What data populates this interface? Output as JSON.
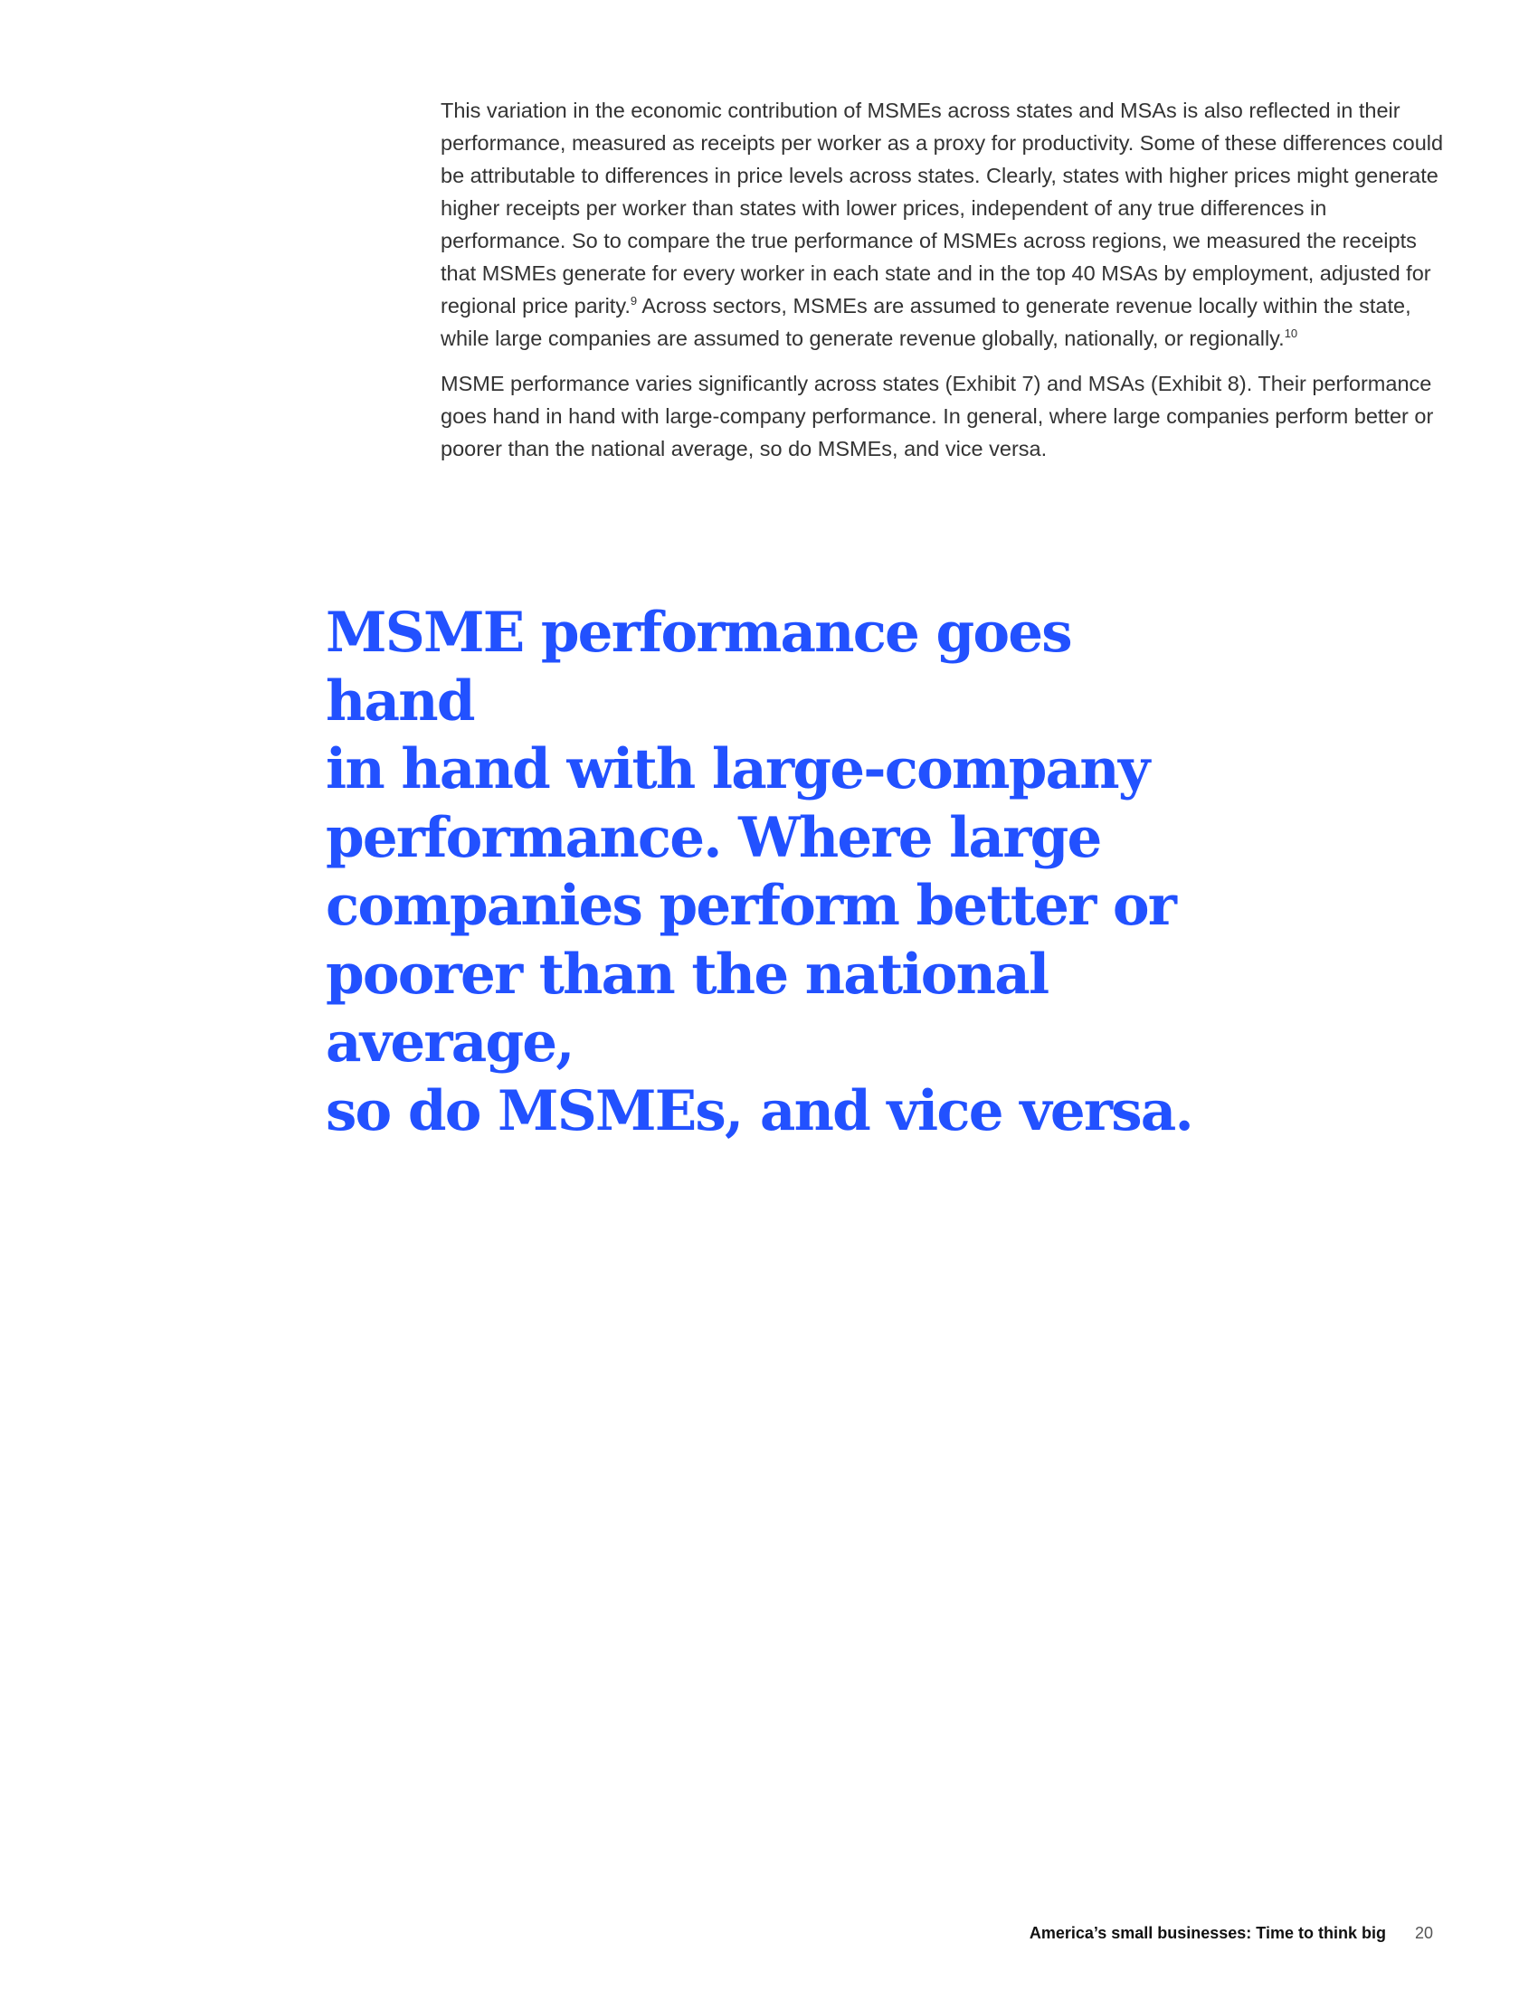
{
  "body": {
    "paragraph_1": {
      "text": "This variation in the economic contribution of MSMEs across states and MSAs is also reflected in their performance, measured as receipts per worker as a proxy for productivity. Some of these differences could be attributable to differences in price levels across states. Clearly, states with higher prices might generate higher receipts per worker than states with lower prices, independent of any true differences in performance. So to compare the true performance of MSMEs across regions, we measured the receipts that MSMEs generate for every worker in each state and in the top 40 MSAs by employment, adjusted for regional price parity.",
      "footnote_9": "9",
      "text_cont": " Across sectors, MSMEs are assumed to generate revenue locally within the state, while large companies are assumed to generate revenue globally, nationally, or regionally.",
      "footnote_10": "10"
    },
    "paragraph_2": "MSME performance varies significantly across states (Exhibit 7) and MSAs (Exhibit 8). Their performance goes hand in hand with large-company performance. In general, where large companies perform better or poorer than the national average, so do MSMEs, and vice versa."
  },
  "pull_quote": {
    "line_1": "MSME performance goes hand",
    "line_2": "in hand with large-company",
    "line_3": "performance. Where large",
    "line_4": "companies perform better or",
    "line_5": "poorer than the national average,",
    "line_6": "so do MSMEs, and vice versa."
  },
  "footer": {
    "report_title": "America’s small businesses: Time to think big",
    "page_number": "20"
  },
  "colors": {
    "accent": "#2251ff",
    "body_text": "#333333"
  }
}
